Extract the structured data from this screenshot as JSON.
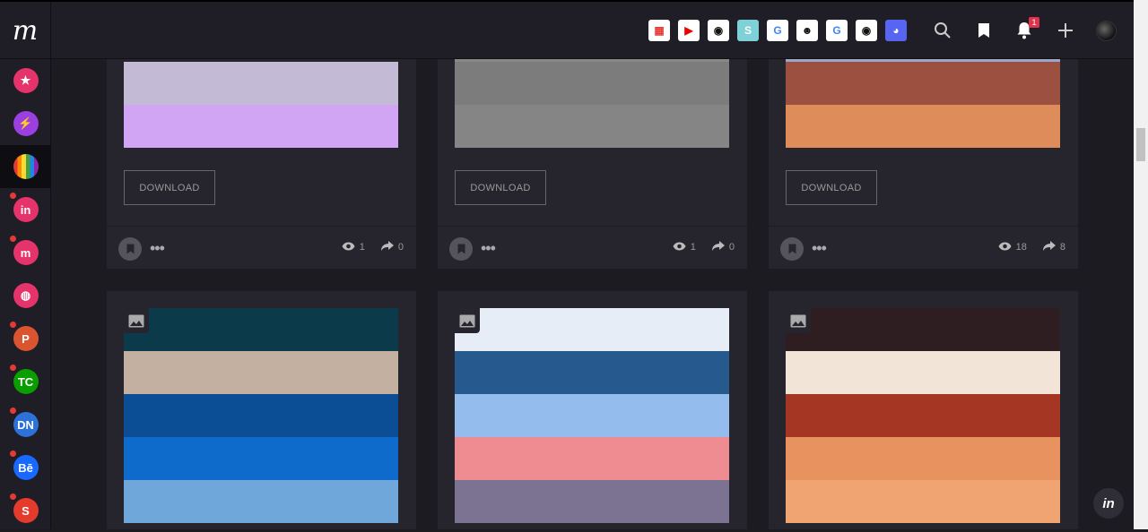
{
  "app": {
    "logo": "m"
  },
  "toolbar": {
    "extensions": [
      {
        "name": "apps-grid-icon",
        "bg": "#ffffff",
        "fg": "#e53935",
        "glyph": "▦"
      },
      {
        "name": "youtube-icon",
        "bg": "#ffffff",
        "fg": "#e00",
        "glyph": "▶"
      },
      {
        "name": "github-icon",
        "bg": "#ffffff",
        "fg": "#111",
        "glyph": "◉"
      },
      {
        "name": "s-ext-icon",
        "bg": "#7fd1d8",
        "fg": "#fff",
        "glyph": "S"
      },
      {
        "name": "google-icon",
        "bg": "#ffffff",
        "fg": "#4285f4",
        "glyph": "G"
      },
      {
        "name": "face-ext-icon",
        "bg": "#ffffff",
        "fg": "#111",
        "glyph": "☻"
      },
      {
        "name": "google-icon-2",
        "bg": "#ffffff",
        "fg": "#4285f4",
        "glyph": "G"
      },
      {
        "name": "github-icon-2",
        "bg": "#ffffff",
        "fg": "#111",
        "glyph": "◉"
      },
      {
        "name": "discord-icon",
        "bg": "#5865f2",
        "fg": "#fff",
        "glyph": "◕"
      }
    ],
    "notification_count": "1"
  },
  "sidebar": {
    "items": [
      {
        "name": "sidebar-item-favorites",
        "color": "#e5336b",
        "glyph": "★",
        "dot": false
      },
      {
        "name": "sidebar-item-flash",
        "color": "#9b3fe0",
        "glyph": "⚡",
        "dot": false
      },
      {
        "name": "sidebar-item-colors",
        "color": "rainbow",
        "glyph": "",
        "dot": false
      },
      {
        "name": "sidebar-item-invision",
        "color": "#e5336b",
        "glyph": "in",
        "dot": true
      },
      {
        "name": "sidebar-item-muzli",
        "color": "#e5336b",
        "glyph": "m",
        "dot": true
      },
      {
        "name": "sidebar-item-dribbble",
        "color": "#e5336b",
        "glyph": "◍",
        "dot": false
      },
      {
        "name": "sidebar-item-producthunt",
        "color": "#da552f",
        "glyph": "P",
        "dot": true
      },
      {
        "name": "sidebar-item-techcrunch",
        "color": "#0a9e01",
        "glyph": "TC",
        "dot": true
      },
      {
        "name": "sidebar-item-designernews",
        "color": "#2d72d9",
        "glyph": "DN",
        "dot": true
      },
      {
        "name": "sidebar-item-behance",
        "color": "#1769ff",
        "glyph": "Bē",
        "dot": true
      },
      {
        "name": "sidebar-item-smashing",
        "color": "#e53b2c",
        "glyph": "S",
        "dot": true
      }
    ]
  },
  "cards_top": [
    {
      "swatches": [
        "#c3bad6",
        "#d2a5f4"
      ],
      "download": "DOWNLOAD",
      "views": "1",
      "shares": "0",
      "top_strip": ""
    },
    {
      "swatches": [
        "#7c7c7c",
        "#858585"
      ],
      "download": "DOWNLOAD",
      "views": "1",
      "shares": "0",
      "top_strip": "#888888"
    },
    {
      "swatches": [
        "#9c503f",
        "#de8d5a"
      ],
      "download": "DOWNLOAD",
      "views": "18",
      "shares": "8",
      "top_strip": "#9aa7cc"
    }
  ],
  "cards_bottom": [
    {
      "swatches": [
        "#0b3a4b",
        "#c4b0a0",
        "#0c4e95",
        "#0e6bcb",
        "#6fa7db"
      ]
    },
    {
      "swatches": [
        "#e7edf7",
        "#265a8f",
        "#94bcec",
        "#ee8c91",
        "#7b7391"
      ]
    },
    {
      "swatches": [
        "#2e1e22",
        "#f2e4d7",
        "#a53623",
        "#e89260",
        "#f0a472"
      ]
    }
  ],
  "fab": {
    "label": "in"
  }
}
